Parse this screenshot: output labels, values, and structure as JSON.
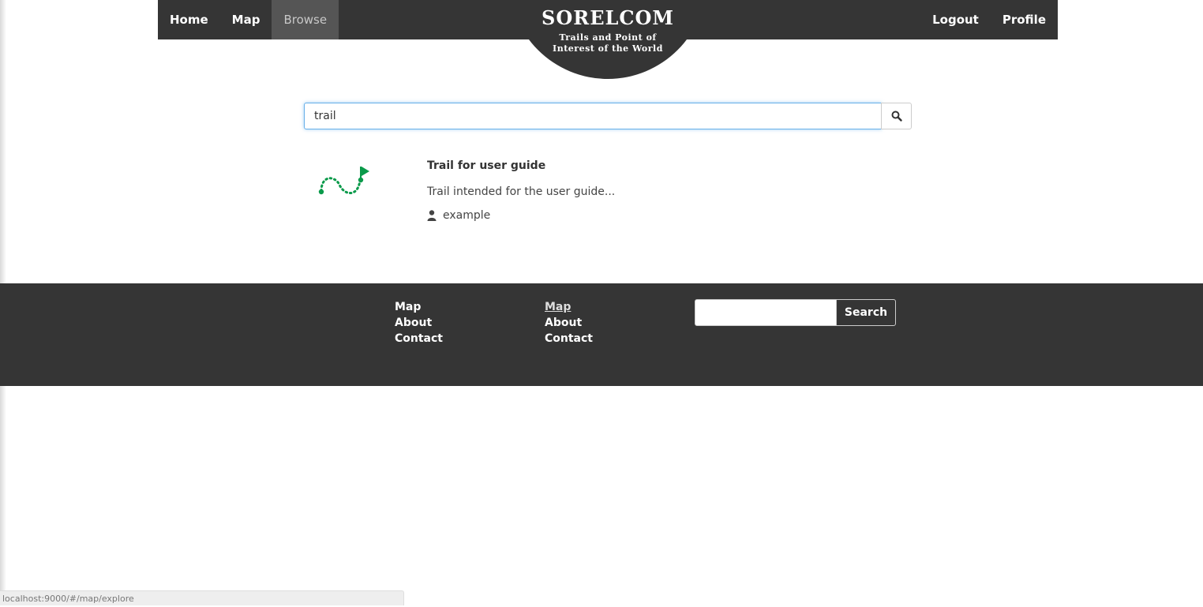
{
  "nav": {
    "left": [
      {
        "label": "Home",
        "active": false
      },
      {
        "label": "Map",
        "active": false
      },
      {
        "label": "Browse",
        "active": true
      }
    ],
    "right": [
      {
        "label": "Logout"
      },
      {
        "label": "Profile"
      }
    ]
  },
  "logo": {
    "title": "SORELCOM",
    "subtitle_line1": "Trails and Point of",
    "subtitle_line2": "Interest of the World"
  },
  "search": {
    "value": "trail",
    "button_icon": "search-icon"
  },
  "results": [
    {
      "icon": "trail-icon",
      "title": "Trail for user guide",
      "description": "Trail intended for the user guide...",
      "user_icon": "user-icon",
      "user": "example"
    }
  ],
  "footer": {
    "col1": [
      "Map",
      "About",
      "Contact"
    ],
    "col2": [
      "Map",
      "About",
      "Contact"
    ],
    "search_button": "Search"
  },
  "status_url": "localhost:9000/#/map/explore",
  "colors": {
    "header_bg": "#353535",
    "active_tab_bg": "#555555",
    "trail_green": "#0a9a4a",
    "focus_border": "#66afe9"
  }
}
